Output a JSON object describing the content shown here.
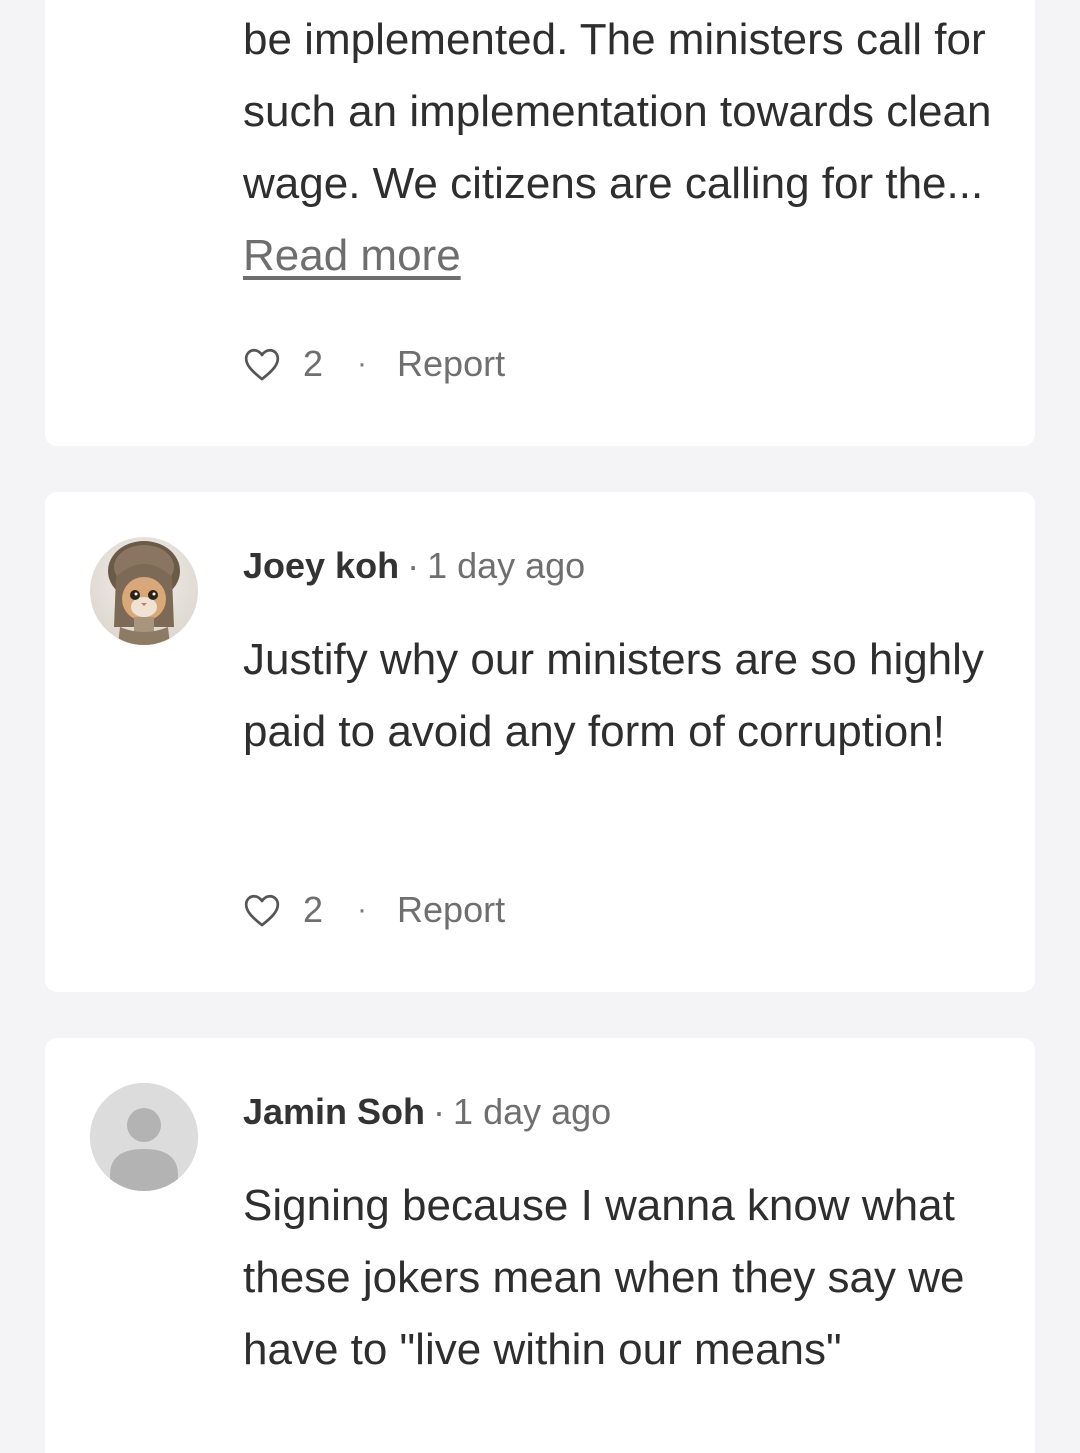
{
  "comments": [
    {
      "body_visible": "be implemented. The ministers call for such an implementation towards clean wage. We citizens are calling for the...",
      "read_more_label": "Read more",
      "likes": "2",
      "separator": "·",
      "report_label": "Report"
    },
    {
      "author": "Joey koh",
      "separator": "·",
      "time": "1 day ago",
      "body": "Justify why our ministers are so highly paid to avoid any form of corruption!",
      "likes": "2",
      "report_label": "Report",
      "avatar_icon": "cat-photo-avatar"
    },
    {
      "author": "Jamin Soh",
      "separator": "·",
      "time": "1 day ago",
      "body": "Signing because I wanna know what these jokers mean when they say we have to \"live within our means\"",
      "avatar_icon": "default-user-avatar"
    }
  ],
  "colors": {
    "page_background": "#f4f3f6",
    "card_background": "#ffffff",
    "text": "#2e2e2e",
    "muted": "#6f6f6f",
    "placeholder_avatar": "#dcdcdc"
  }
}
